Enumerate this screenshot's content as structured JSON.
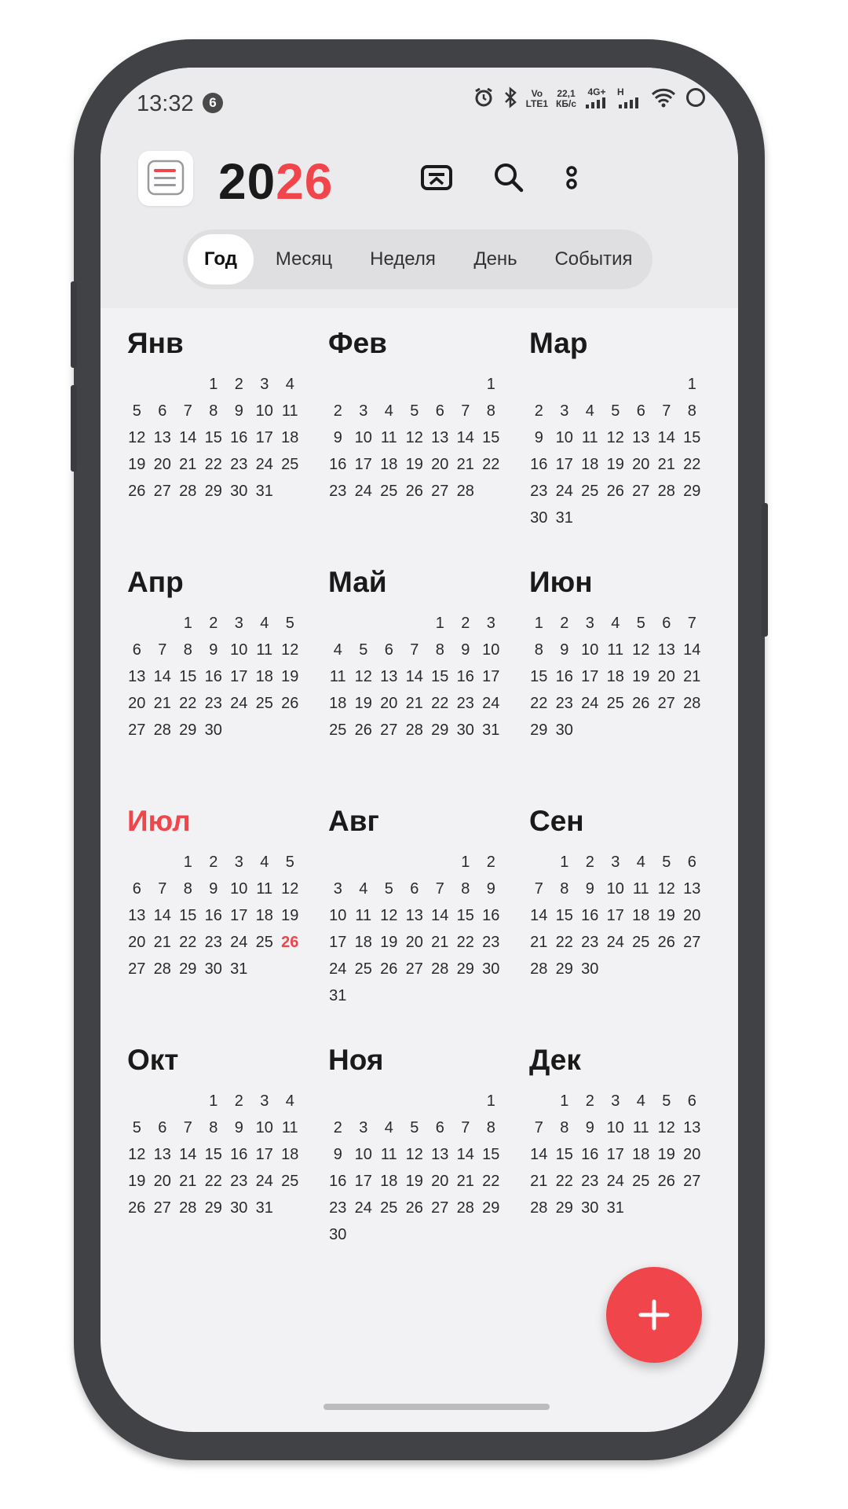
{
  "status": {
    "time": "13:32",
    "badge": "6",
    "volte_top": "Vo",
    "volte_bottom": "LTE1",
    "speed_top": "22,1",
    "speed_bottom": "КБ/с",
    "net1": "4G+",
    "net2": "H"
  },
  "header": {
    "year_prefix": "20",
    "year_suffix": "26"
  },
  "tabs": [
    {
      "label": "Год",
      "active": true
    },
    {
      "label": "Месяц",
      "active": false
    },
    {
      "label": "Неделя",
      "active": false
    },
    {
      "label": "День",
      "active": false
    },
    {
      "label": "События",
      "active": false
    }
  ],
  "colors": {
    "accent": "#f0454a",
    "background": "#f2f2f4",
    "header_bg": "#ebebed",
    "phone_frame": "#404245"
  },
  "icons": [
    "menu-icon",
    "today-icon",
    "search-icon",
    "more-vert-icon",
    "add-icon"
  ],
  "year": 2026,
  "today": {
    "month_index": 6,
    "day": 26
  },
  "months": [
    {
      "name": "Янв",
      "offset": 3,
      "days": 31
    },
    {
      "name": "Фев",
      "offset": 6,
      "days": 28
    },
    {
      "name": "Мар",
      "offset": 6,
      "days": 31
    },
    {
      "name": "Апр",
      "offset": 2,
      "days": 30
    },
    {
      "name": "Май",
      "offset": 4,
      "days": 31
    },
    {
      "name": "Июн",
      "offset": 0,
      "days": 30
    },
    {
      "name": "Июл",
      "offset": 2,
      "days": 31
    },
    {
      "name": "Авг",
      "offset": 5,
      "days": 31
    },
    {
      "name": "Сен",
      "offset": 1,
      "days": 30
    },
    {
      "name": "Окт",
      "offset": 3,
      "days": 31
    },
    {
      "name": "Ноя",
      "offset": 6,
      "days": 30
    },
    {
      "name": "Дек",
      "offset": 1,
      "days": 31
    }
  ]
}
